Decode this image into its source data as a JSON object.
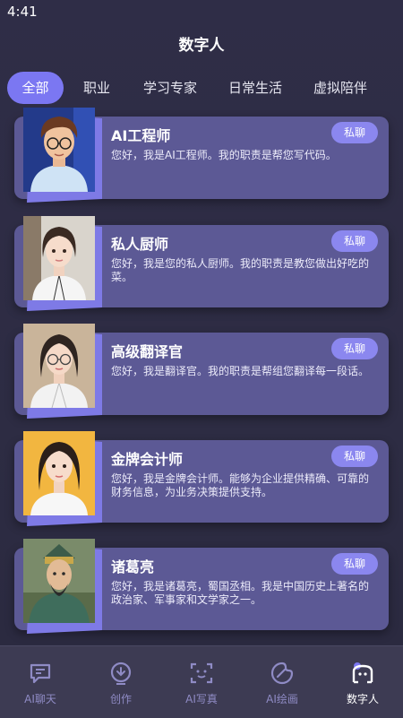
{
  "status": {
    "time": "4:41"
  },
  "header": {
    "title": "数字人"
  },
  "tabs": [
    {
      "label": "全部"
    },
    {
      "label": "职业"
    },
    {
      "label": "学习专家"
    },
    {
      "label": "日常生活"
    },
    {
      "label": "虚拟陪伴"
    }
  ],
  "cards": [
    {
      "name": "AI工程师",
      "desc": "您好，我是AI工程师。我的职责是帮您写代码。",
      "button": "私聊"
    },
    {
      "name": "私人厨师",
      "desc": "您好，我是您的私人厨师。我的职责是教您做出好吃的菜。",
      "button": "私聊"
    },
    {
      "name": "高级翻译官",
      "desc": "您好，我是翻译官。我的职责是帮组您翻译每一段话。",
      "button": "私聊"
    },
    {
      "name": "金牌会计师",
      "desc": "您好，我是金牌会计师。能够为企业提供精确、可靠的财务信息，为业务决策提供支持。",
      "button": "私聊"
    },
    {
      "name": "诸葛亮",
      "desc": "您好，我是诸葛亮，蜀国丞相。我是中国历史上著名的政治家、军事家和文学家之一。",
      "button": "私聊"
    }
  ],
  "nav": [
    {
      "label": "AI聊天",
      "icon": "chat-icon"
    },
    {
      "label": "创作",
      "icon": "create-icon"
    },
    {
      "label": "AI写真",
      "icon": "face-scan-icon"
    },
    {
      "label": "AI绘画",
      "icon": "palette-icon"
    },
    {
      "label": "数字人",
      "icon": "digital-human-icon"
    }
  ]
}
